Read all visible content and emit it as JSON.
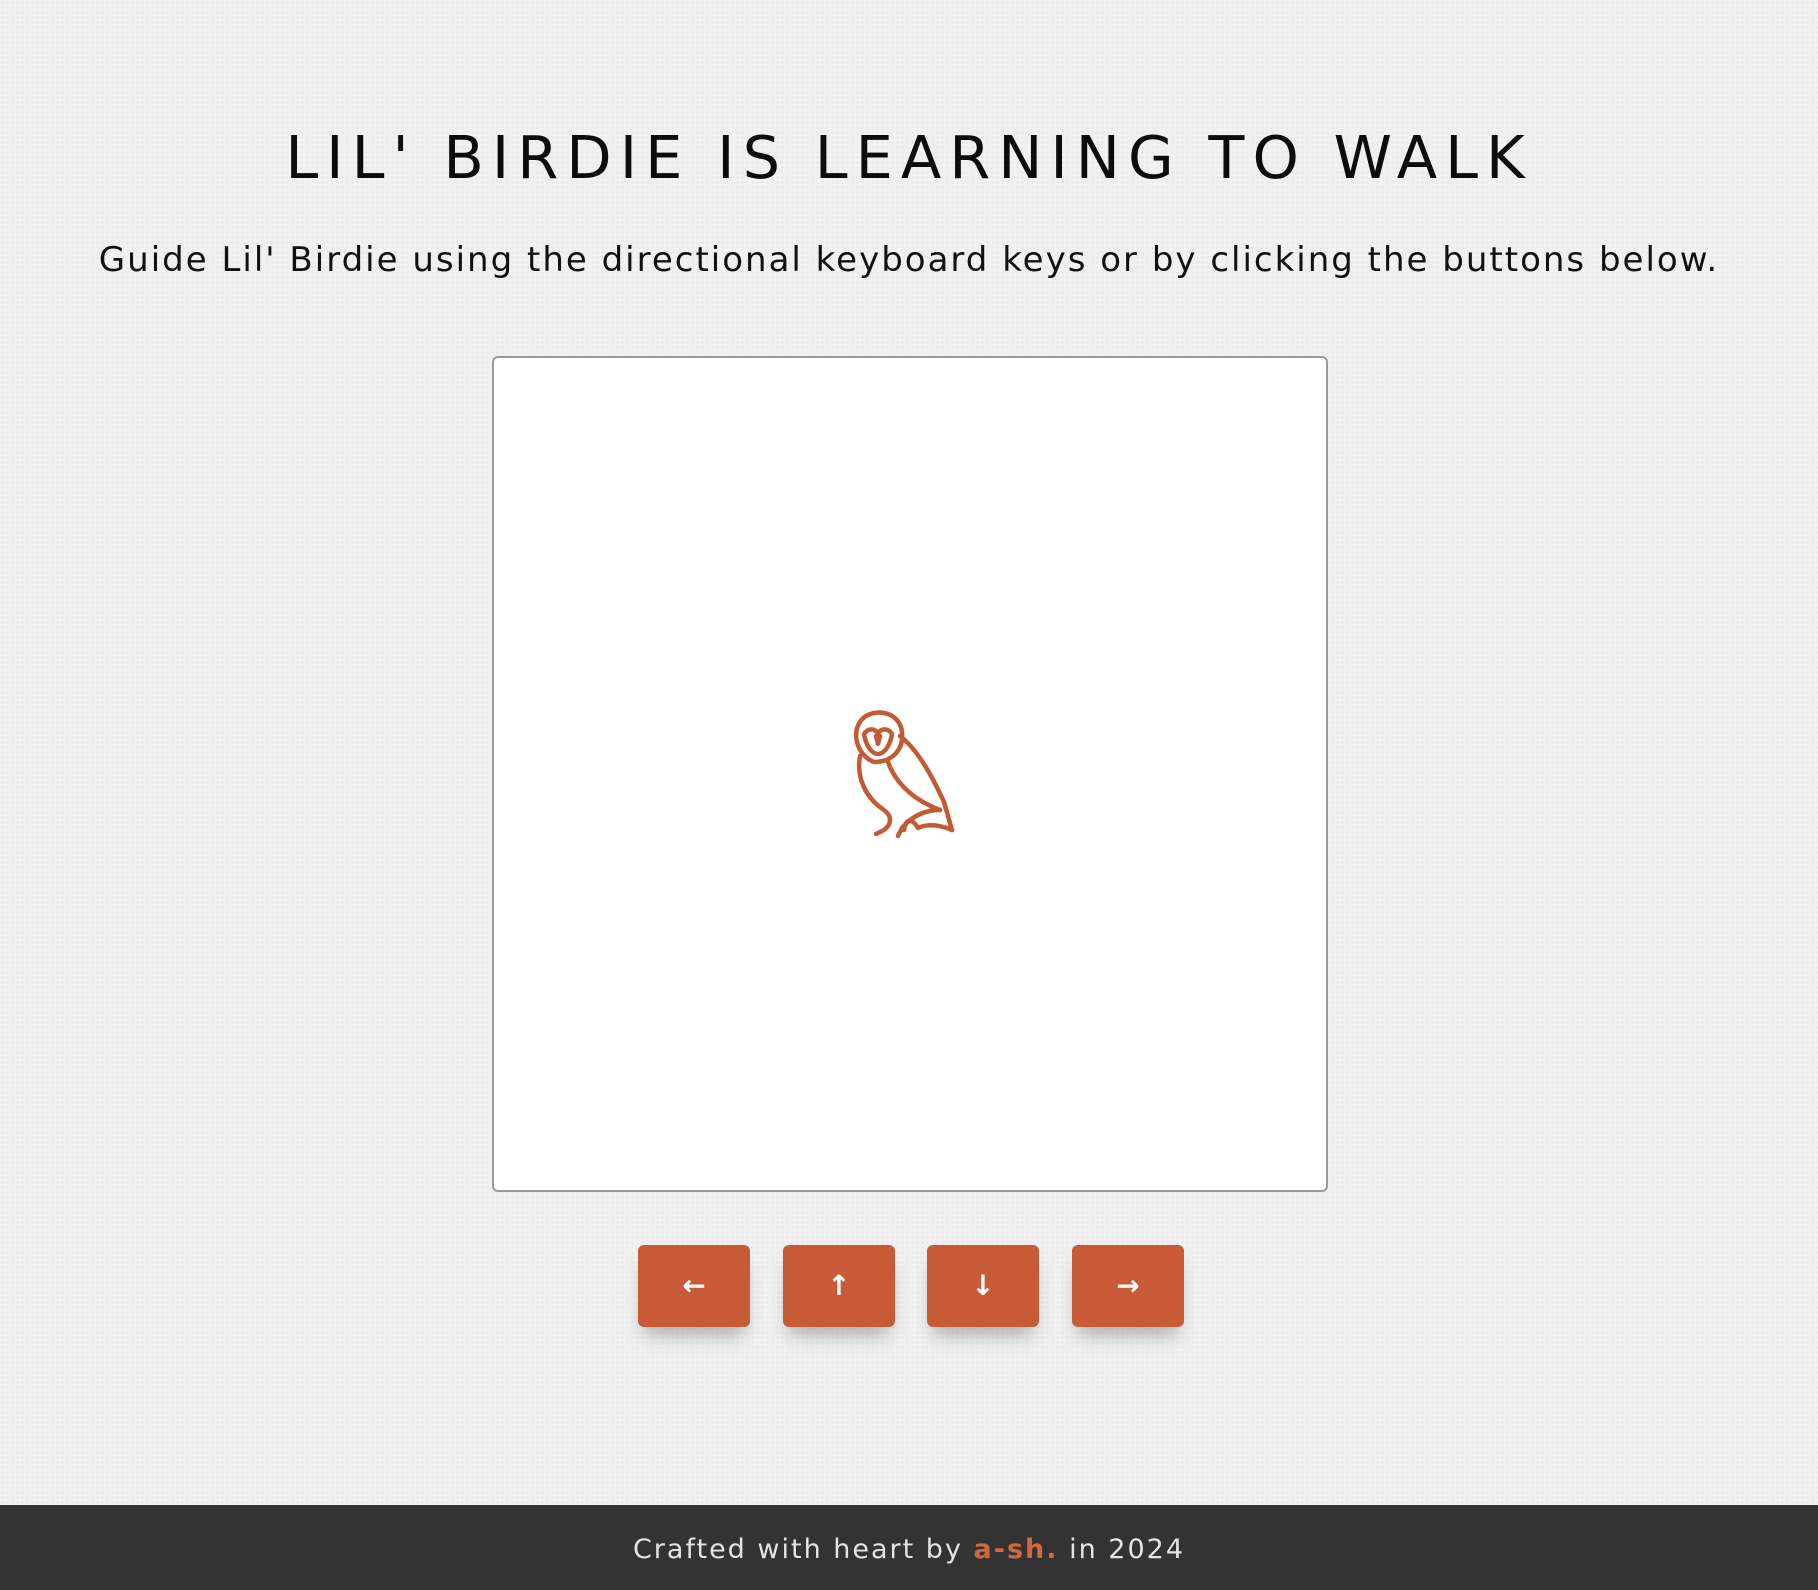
{
  "header": {
    "title": "LIL' BIRDIE IS LEARNING TO WALK",
    "subtitle": "Guide Lil' Birdie using the directional keyboard keys or by clicking the buttons below."
  },
  "stage": {
    "character_icon": "owl-icon",
    "character_color": "#c45a33"
  },
  "controls": {
    "left_label": "←",
    "up_label": "↑",
    "down_label": "↓",
    "right_label": "→",
    "button_color": "#c95a37"
  },
  "footer": {
    "prefix": "Crafted with heart by",
    "author": "a-sh.",
    "suffix": "in 2024",
    "author_color": "#d2663c",
    "background": "#333333"
  }
}
